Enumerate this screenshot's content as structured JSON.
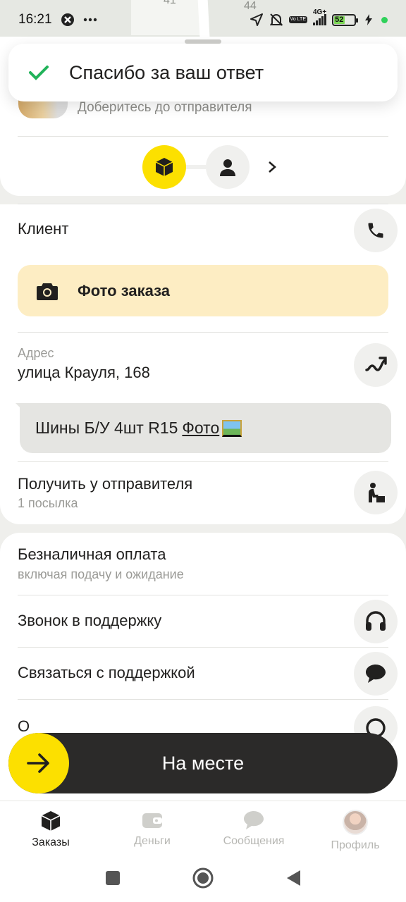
{
  "status_bar": {
    "time": "16:21",
    "icons": [
      "alarm-icon",
      "more-icon",
      "location-icon",
      "bell-muted-icon",
      "volte-icon",
      "signal-icon",
      "charging-icon"
    ],
    "network": "4G+",
    "volte": "Vo LTE",
    "battery": "52",
    "battery_level": 0.52
  },
  "map": {
    "labels": [
      "41",
      "44"
    ]
  },
  "toast": {
    "text": "Спасибо за ваш ответ",
    "icon": "check-icon",
    "icon_color": "#21b35a"
  },
  "top_card": {
    "subtitle": "Доберитесь до отправителя"
  },
  "client": {
    "label": "Клиент",
    "icon": "phone-icon"
  },
  "photo_order": {
    "label": "Фото заказа",
    "icon": "camera-icon"
  },
  "address": {
    "caption": "Адрес",
    "value": "улица Крауля, 168",
    "icon": "route-icon"
  },
  "comment": {
    "text": "Шины Б/У 4шт R15",
    "link": "Фото"
  },
  "pickup": {
    "title": "Получить у отправителя",
    "sub": "1 посылка",
    "icon": "parcel-person-icon"
  },
  "payment": {
    "title": "Безналичная оплата",
    "sub": "включая подачу и ожидание"
  },
  "support_call": {
    "label": "Звонок в поддержку",
    "icon": "headset-icon"
  },
  "support_chat": {
    "label": "Связаться с поддержкой",
    "icon": "chat-bubble-icon"
  },
  "partial_row": {
    "label": "О"
  },
  "action": {
    "label": "На месте",
    "icon": "arrow-right-icon",
    "accent": "#fce000"
  },
  "bottom_nav": [
    {
      "label": "Заказы",
      "icon": "orders-box-icon"
    },
    {
      "label": "Деньги",
      "icon": "wallet-icon"
    },
    {
      "label": "Сообщения",
      "icon": "message-icon"
    },
    {
      "label": "Профиль",
      "icon": "avatar"
    }
  ],
  "colors": {
    "yellow": "#fce000",
    "beige": "#fdedc3",
    "dark": "#2b2a29"
  }
}
